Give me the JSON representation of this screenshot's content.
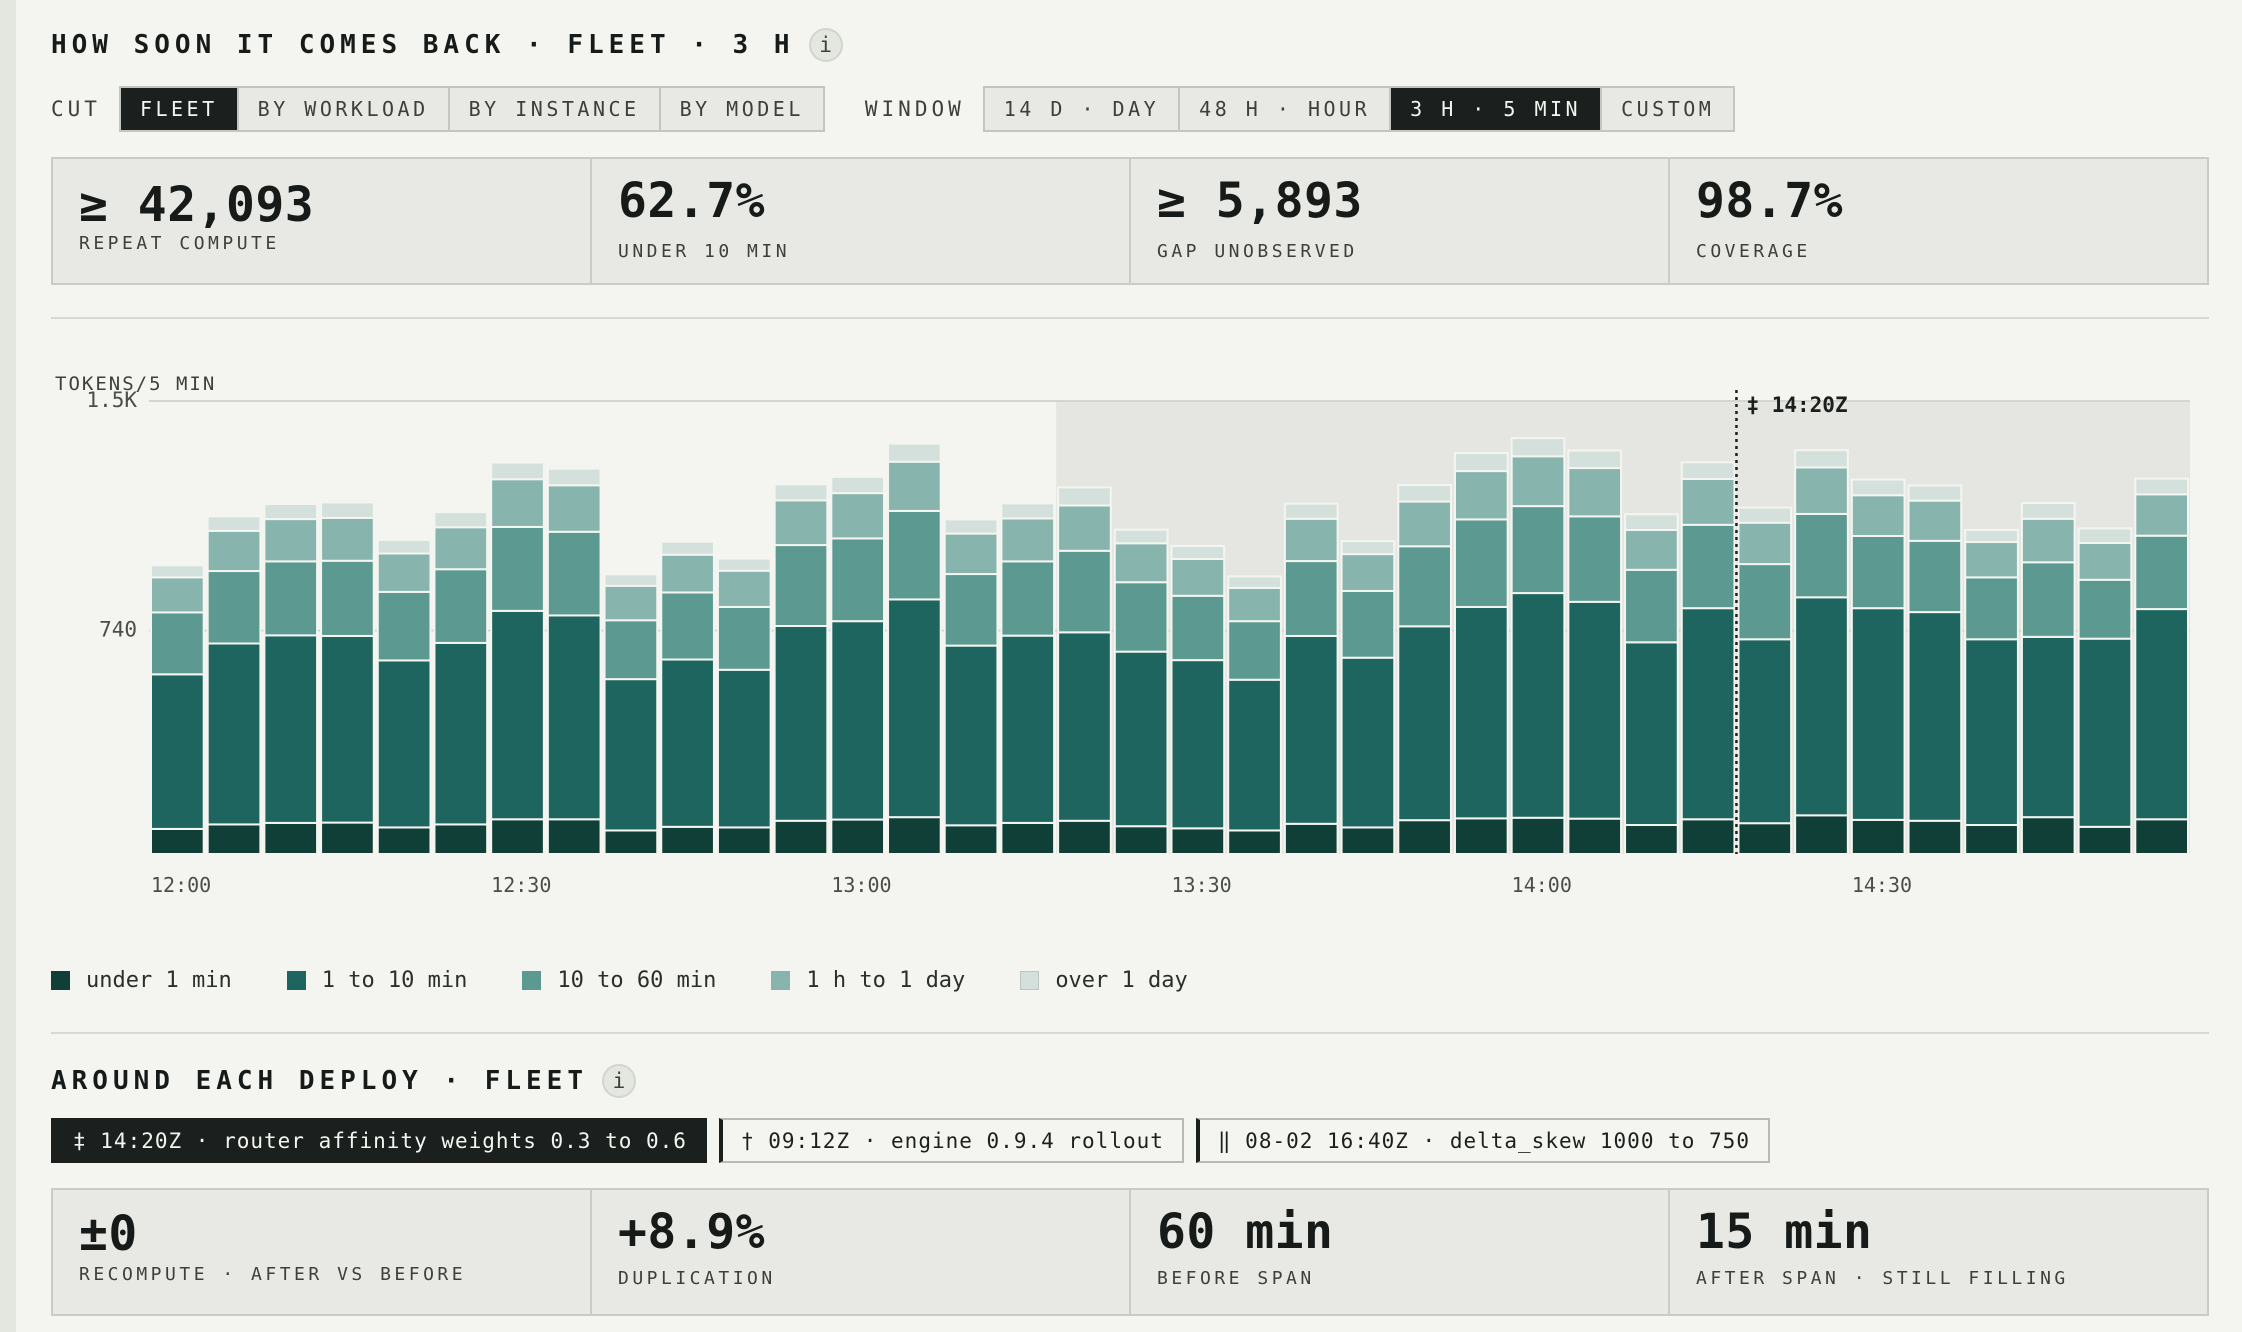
{
  "header": {
    "title": "HOW SOON IT COMES BACK · FLEET · 3 H",
    "info": "i"
  },
  "controls": {
    "cut_label": "CUT",
    "cut_options": [
      "FLEET",
      "BY WORKLOAD",
      "BY INSTANCE",
      "BY MODEL"
    ],
    "cut_selected": "FLEET",
    "window_label": "WINDOW",
    "window_options": [
      "14 D · DAY",
      "48 H · HOUR",
      "3 H · 5 MIN",
      "CUSTOM"
    ],
    "window_selected": "3 H · 5 MIN"
  },
  "stats": [
    {
      "value": "≥ 42,093",
      "label": "REPEAT COMPUTE"
    },
    {
      "value": "62.7%",
      "label": "UNDER 10 MIN"
    },
    {
      "value": "≥ 5,893",
      "label": "GAP UNOBSERVED"
    },
    {
      "value": "98.7%",
      "label": "COVERAGE"
    }
  ],
  "deploy_section": {
    "title": "AROUND EACH DEPLOY · FLEET",
    "info": "i",
    "deploys": [
      {
        "label": "‡ 14:20Z · router affinity weights 0.3 to 0.6",
        "active": true
      },
      {
        "label": "† 09:12Z · engine 0.9.4 rollout",
        "active": false
      },
      {
        "label": "‖ 08-02 16:40Z · delta_skew 1000 to 750",
        "active": false
      }
    ],
    "stats": [
      {
        "value": "±0",
        "label": "RECOMPUTE · AFTER VS BEFORE"
      },
      {
        "value": "+8.9%",
        "label": "DUPLICATION"
      },
      {
        "value": "60 min",
        "label": "BEFORE SPAN"
      },
      {
        "value": "15 min",
        "label": "AFTER SPAN · STILL FILLING"
      }
    ]
  },
  "chart_data": {
    "type": "bar",
    "stacked": true,
    "ylabel": "TOKENS/5 MIN",
    "y_ticks": [
      {
        "value": 740,
        "label": "740"
      },
      {
        "value": 1500,
        "label": "1.5K"
      }
    ],
    "ylim": [
      0,
      1500
    ],
    "x_start": "12:00",
    "x_step_min": 5,
    "x_tick_labels": [
      "12:00",
      "12:30",
      "13:00",
      "13:30",
      "14:00",
      "14:30"
    ],
    "x_tick_index": [
      0,
      6,
      12,
      18,
      24,
      30
    ],
    "categories": [
      "12:00",
      "12:05",
      "12:10",
      "12:15",
      "12:20",
      "12:25",
      "12:30",
      "12:35",
      "12:40",
      "12:45",
      "12:50",
      "12:55",
      "13:00",
      "13:05",
      "13:10",
      "13:15",
      "13:20",
      "13:25",
      "13:30",
      "13:35",
      "13:40",
      "13:45",
      "13:50",
      "13:55",
      "14:00",
      "14:05",
      "14:10",
      "14:15",
      "14:20",
      "14:25",
      "14:30",
      "14:35",
      "14:40",
      "14:45",
      "14:50",
      "14:55"
    ],
    "shaded_from_index": 16,
    "marker": {
      "label": "‡ 14:20Z",
      "at": "14:20"
    },
    "grid": true,
    "legend_position": "bottom",
    "series": [
      {
        "name": "under 1 min",
        "color": "#103f38",
        "values": [
          83,
          98,
          103,
          104,
          88,
          98,
          115,
          115,
          78,
          90,
          88,
          110,
          114,
          122,
          95,
          103,
          110,
          92,
          85,
          78,
          100,
          88,
          112,
          118,
          120,
          117,
          96,
          115,
          102,
          128,
          113,
          110,
          96,
          122,
          90,
          115
        ]
      },
      {
        "name": "1 to 10 min",
        "color": "#1e6560",
        "values": [
          512,
          599,
          621,
          618,
          553,
          601,
          690,
          675,
          501,
          554,
          522,
          645,
          657,
          721,
          595,
          620,
          624,
          578,
          557,
          499,
          622,
          562,
          642,
          700,
          744,
          718,
          605,
          699,
          609,
          722,
          701,
          691,
          615,
          597,
          623,
          696
        ]
      },
      {
        "name": "10 to 60 min",
        "color": "#5c9a91",
        "values": [
          205,
          240,
          245,
          249,
          227,
          244,
          278,
          277,
          195,
          222,
          208,
          268,
          274,
          293,
          237,
          246,
          270,
          230,
          213,
          194,
          248,
          221,
          265,
          290,
          288,
          283,
          240,
          276,
          249,
          276,
          239,
          236,
          205,
          247,
          195,
          243
        ]
      },
      {
        "name": "1 h to 1 day",
        "color": "#88b4ae",
        "values": [
          116,
          133,
          140,
          142,
          127,
          139,
          158,
          154,
          114,
          125,
          120,
          148,
          150,
          163,
          134,
          142,
          150,
          129,
          122,
          110,
          140,
          122,
          148,
          160,
          165,
          160,
          132,
          152,
          137,
          154,
          135,
          133,
          117,
          144,
          122,
          137
        ]
      },
      {
        "name": "over 1 day",
        "color": "#d3e0dc",
        "values": [
          40,
          48,
          50,
          51,
          45,
          50,
          55,
          55,
          38,
          43,
          40,
          53,
          54,
          60,
          47,
          50,
          60,
          45,
          43,
          38,
          50,
          43,
          55,
          60,
          60,
          58,
          52,
          55,
          50,
          57,
          52,
          50,
          40,
          52,
          48,
          52
        ]
      }
    ]
  }
}
